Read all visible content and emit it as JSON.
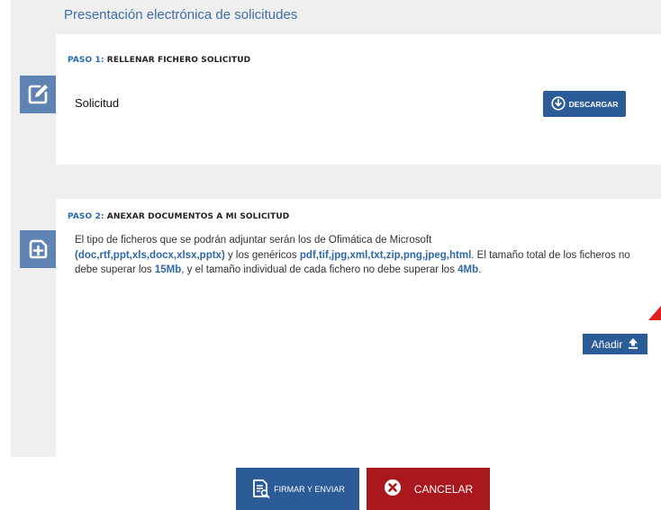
{
  "page": {
    "title": "Presentación electrónica de solicitudes"
  },
  "step1": {
    "label_num": "PASO 1:",
    "label_text": " RELLENAR FICHERO SOLICITUD",
    "item_label": "Solicitud",
    "download_button": "DESCARGAR"
  },
  "step2": {
    "label_num": "PASO 2:",
    "label_text": " ANEXAR DOCUMENTOS A MI SOLICITUD",
    "desc_1": "El tipo de ficheros que se podrán adjuntar serán los de Ofimática de Microsoft",
    "desc_ms_types": "(doc,rtf,ppt,xls,docx,xlsx,pptx)",
    "desc_2": " y los genéricos ",
    "desc_generic_types": "pdf,tif,jpg,xml,txt,zip,png,jpeg,html",
    "desc_3": ". El tamaño total de los ficheros no debe superar los ",
    "desc_total_size": "15Mb",
    "desc_4": ", y el tamaño individual de cada fichero no debe superar los ",
    "desc_file_size": "4Mb",
    "desc_5": ".",
    "add_button": "Añadir"
  },
  "actions": {
    "sign_send": "FIRMAR Y ENVIAR",
    "cancel": "CANCELAR"
  },
  "icons": {
    "step1": "edit-icon",
    "step2": "add-document-icon",
    "download": "download-circle-icon",
    "upload": "upload-icon",
    "sign": "sign-document-icon",
    "cancel": "close-circle-icon"
  },
  "colors": {
    "accent": "#2c5c97",
    "title": "#3e6ea5",
    "highlight": "#2f68aa",
    "danger": "#a8181c",
    "icon_bg": "#5f84b4",
    "panel_bg": "#efefef"
  }
}
